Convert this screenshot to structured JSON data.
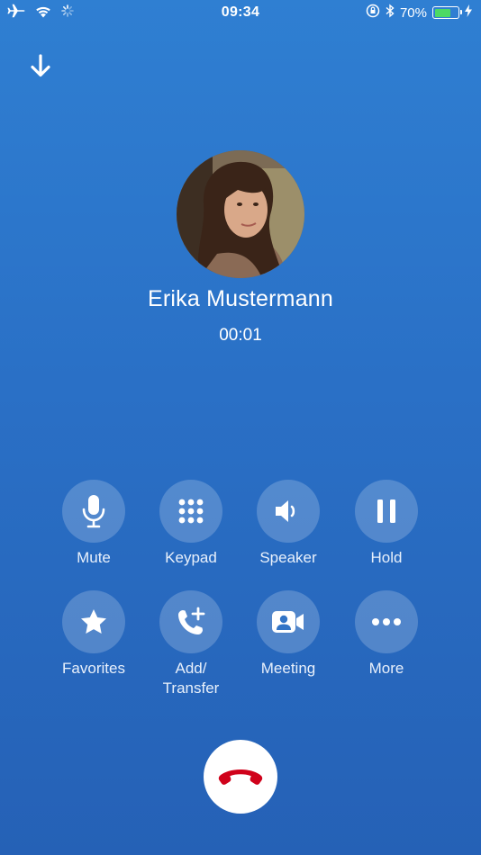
{
  "status_bar": {
    "time": "09:34",
    "battery_percent": "70%",
    "battery_level": 0.7,
    "icons": [
      "airplane-icon",
      "wifi-icon",
      "activity-spinner-icon",
      "orientation-lock-icon",
      "bluetooth-icon",
      "battery-icon",
      "charging-icon"
    ]
  },
  "call": {
    "caller_name": "Erika Mustermann",
    "duration": "00:01"
  },
  "controls": {
    "row1": [
      {
        "label": "Mute",
        "icon": "microphone-icon"
      },
      {
        "label": "Keypad",
        "icon": "keypad-icon"
      },
      {
        "label": "Speaker",
        "icon": "speaker-icon"
      },
      {
        "label": "Hold",
        "icon": "pause-icon"
      }
    ],
    "row2": [
      {
        "label": "Favorites",
        "icon": "star-icon"
      },
      {
        "label": "Add/\nTransfer",
        "label_line1": "Add/",
        "label_line2": "Transfer",
        "icon": "add-call-icon"
      },
      {
        "label": "Meeting",
        "icon": "video-meeting-icon"
      },
      {
        "label": "More",
        "icon": "more-icon"
      }
    ]
  },
  "colors": {
    "background_top": "#2f7fd2",
    "background_bottom": "#2561b6",
    "end_call_red": "#d0021b",
    "battery_green": "#4cd964"
  }
}
